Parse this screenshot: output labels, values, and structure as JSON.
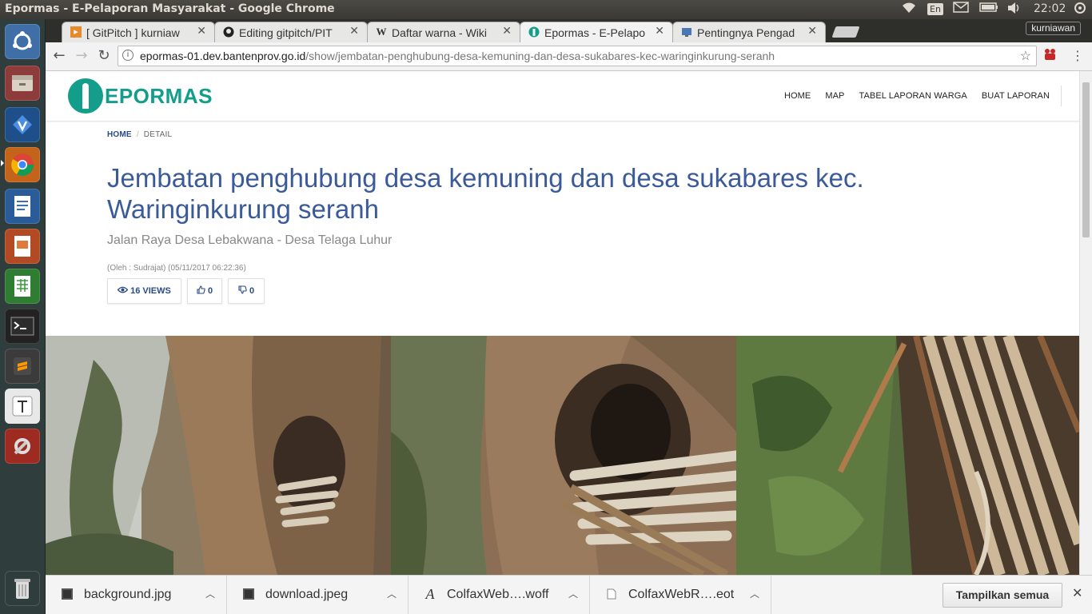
{
  "os": {
    "window_title": "Epormas - E-Pelaporan Masyarakat - Google Chrome",
    "keyboard_lang": "En",
    "clock": "22:02"
  },
  "launcher": {
    "items": [
      "ubuntu-dash-icon",
      "files-icon",
      "xapp-icon",
      "chrome-icon",
      "writer-icon",
      "impress-icon",
      "calc-icon",
      "terminal-icon",
      "sublime-text-icon",
      "typora-icon",
      "system-settings-icon",
      "trash-icon"
    ]
  },
  "browser": {
    "tabs": [
      {
        "title": "[ GitPitch ] kurniaw",
        "favicon": "gitpitch-icon",
        "active": false
      },
      {
        "title": "Editing gitpitch/PIT",
        "favicon": "github-icon",
        "active": false
      },
      {
        "title": "Daftar warna - Wiki",
        "favicon": "wikipedia-icon",
        "active": false
      },
      {
        "title": "Epormas - E-Pelapo",
        "favicon": "epormas-icon",
        "active": true
      },
      {
        "title": "Pentingnya Pengad",
        "favicon": "page-icon",
        "active": false
      }
    ],
    "profile_name": "kurniawan",
    "url_host": "epormas-01.dev.bantenprov.go.id",
    "url_path": "/show/jembatan-penghubung-desa-kemuning-dan-desa-sukabares-kec-waringinkurung-seranh"
  },
  "site": {
    "logo_text": "EPORMAS",
    "nav": [
      "HOME",
      "MAP",
      "TABEL LAPORAN WARGA",
      "BUAT LAPORAN"
    ],
    "breadcrumb": {
      "home": "HOME",
      "current": "DETAIL"
    },
    "report": {
      "title": "Jembatan penghubung desa kemuning dan desa sukabares kec. Waringinkurung seranh",
      "address": "Jalan Raya Desa Lebakwana - Desa Telaga Luhur",
      "meta": "(Oleh : Sudrajat) (05/11/2017 06:22:36)",
      "views": "16 VIEWS",
      "likes": "0",
      "dislikes": "0"
    }
  },
  "downloads": {
    "items": [
      {
        "name": "background.jpg",
        "icon": "image-file-icon"
      },
      {
        "name": "download.jpeg",
        "icon": "image-file-icon"
      },
      {
        "name": "ColfaxWeb….woff",
        "icon": "font-file-icon"
      },
      {
        "name": "ColfaxWebR….eot",
        "icon": "document-file-icon"
      }
    ],
    "show_all": "Tampilkan semua"
  }
}
